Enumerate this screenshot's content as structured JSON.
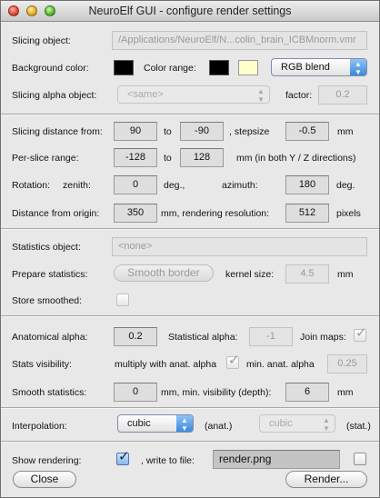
{
  "window": {
    "title": "NeuroElf GUI - configure render settings"
  },
  "colors": {
    "background_color": "#000000",
    "color_range_low": "#000000",
    "color_range_high": "#ffffcc",
    "accent": "#3b89e0"
  },
  "slicing": {
    "object_label": "Slicing object:",
    "object_value": "/Applications/NeuroElf/N...colin_brain_ICBMnorm.vmr",
    "bg_color_label": "Background color:",
    "color_range_label": "Color range:",
    "blend_mode": "RGB blend",
    "alpha_object_label": "Slicing alpha object:",
    "alpha_object_value": "<same>",
    "factor_label": "factor:",
    "factor_value": "0.2"
  },
  "distance": {
    "from_label": "Slicing distance from:",
    "from_value": "90",
    "to_label": "to",
    "to_value": "-90",
    "stepsize_label": ", stepsize",
    "stepsize_value": "-0.5",
    "unit": "mm",
    "per_slice_label": "Per-slice range:",
    "per_slice_from": "-128",
    "per_slice_to_label": "to",
    "per_slice_to": "128",
    "per_slice_note": "mm  (in both Y / Z directions)",
    "rotation_label": "Rotation:",
    "zenith_label": "zenith:",
    "zenith_value": "0",
    "deg_label": "deg.,",
    "azimuth_label": "azimuth:",
    "azimuth_value": "180",
    "deg_label2": "deg.",
    "origin_label": "Distance from origin:",
    "origin_value": "350",
    "resolution_label": "mm, rendering resolution:",
    "resolution_value": "512",
    "pixels_label": "pixels"
  },
  "statistics": {
    "object_label": "Statistics object:",
    "object_value": "<none>",
    "prepare_label": "Prepare statistics:",
    "smooth_button": "Smooth border",
    "kernel_label": "kernel size:",
    "kernel_value": "4.5",
    "kernel_unit": "mm",
    "store_label": "Store smoothed:",
    "store_checked": false
  },
  "alpha": {
    "anat_label": "Anatomical alpha:",
    "anat_value": "0.2",
    "stat_label": "Statistical alpha:",
    "stat_value": "-1",
    "join_label": "Join maps:",
    "join_checked": true,
    "visibility_label": "Stats visibility:",
    "multiply_label": "multiply with anat. alpha",
    "multiply_checked": true,
    "min_anat_label": "min. anat. alpha",
    "min_anat_value": "0.25",
    "smooth_label": "Smooth statistics:",
    "smooth_value": "0",
    "min_vis_label": "mm,  min. visibility (depth):",
    "min_vis_value": "6",
    "unit": "mm"
  },
  "interpolation": {
    "label": "Interpolation:",
    "anat_value": "cubic",
    "anat_label": "(anat.)",
    "stat_value": "cubic",
    "stat_label": "(stat.)"
  },
  "output": {
    "show_label": "Show rendering:",
    "show_checked": true,
    "write_label": ", write to file:",
    "file_value": "render.png",
    "write_checked": false,
    "close_button": "Close",
    "render_button": "Render..."
  }
}
